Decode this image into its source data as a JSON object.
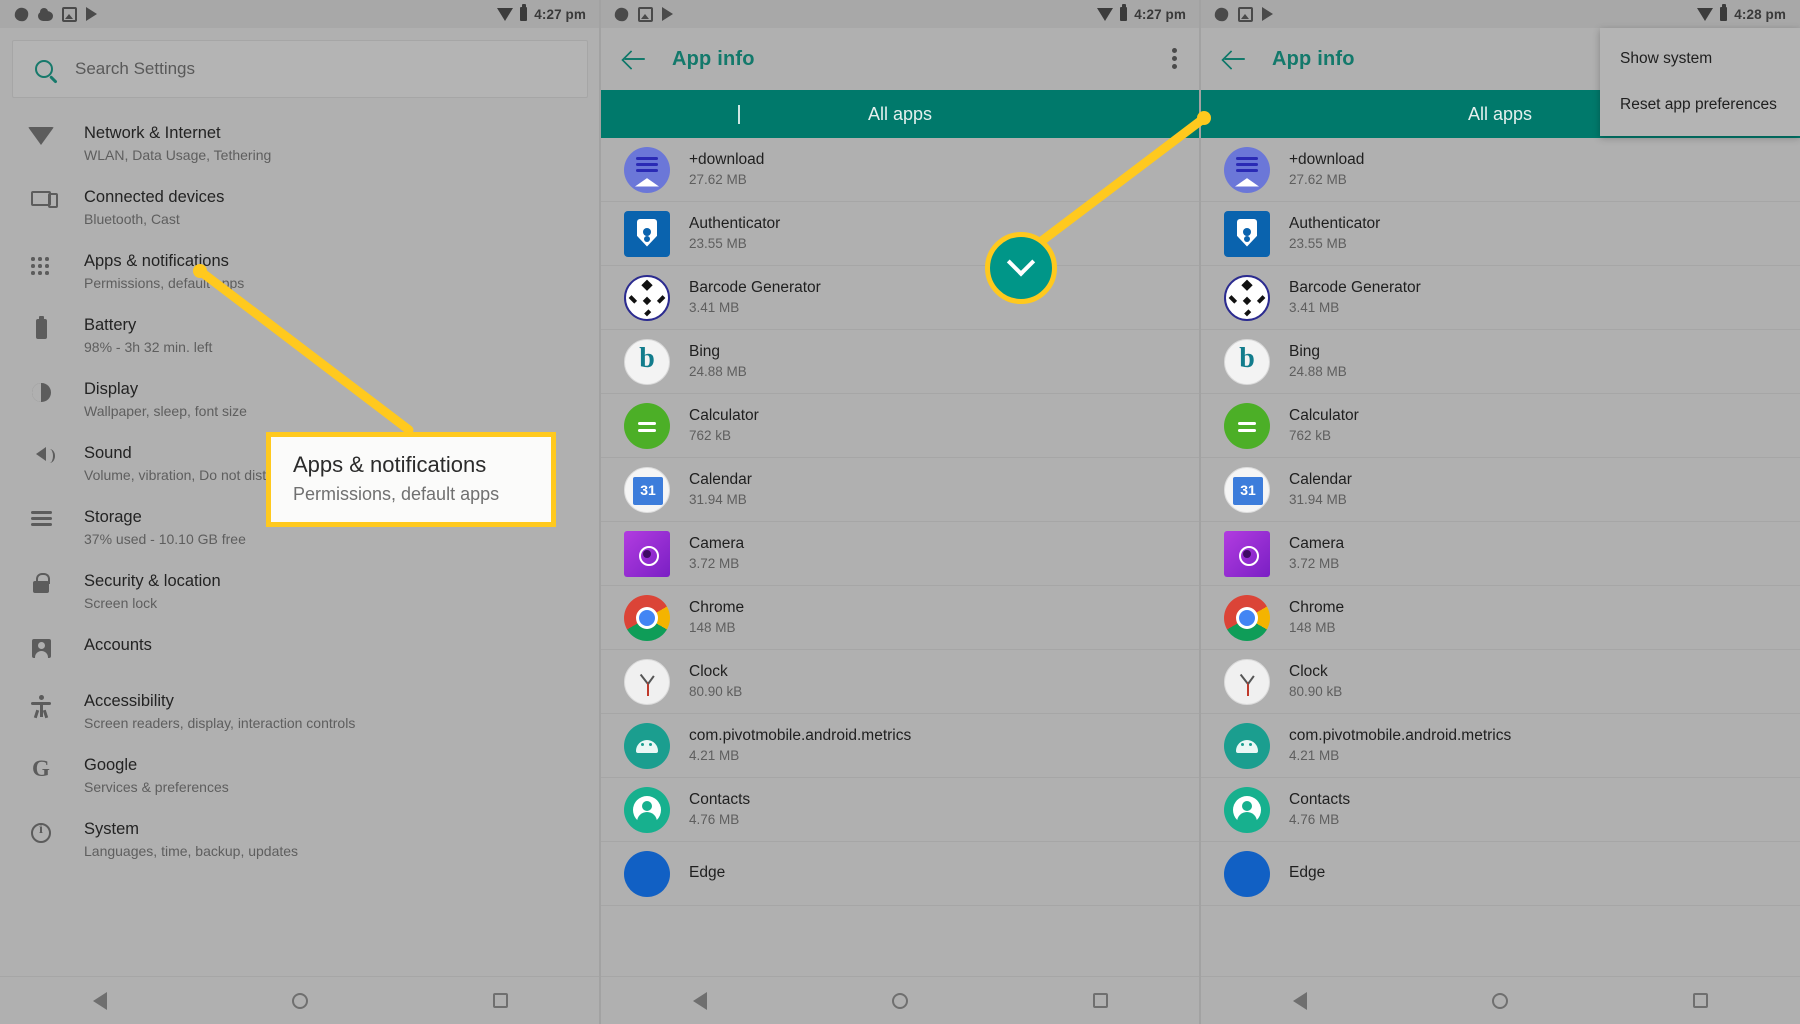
{
  "status_bar": {
    "time_left": "4:27 pm",
    "time_middle": "4:27 pm",
    "time_right": "4:28 pm",
    "icons": [
      "burst-icon",
      "cloud-icon",
      "image-icon",
      "play-icon",
      "wifi-icon",
      "battery-icon"
    ]
  },
  "search": {
    "placeholder": "Search Settings",
    "icon": "search-icon"
  },
  "settings": {
    "items": [
      {
        "icon": "wifi-icon",
        "title": "Network & Internet",
        "subtitle": "WLAN, Data Usage, Tethering"
      },
      {
        "icon": "devices-icon",
        "title": "Connected devices",
        "subtitle": "Bluetooth, Cast"
      },
      {
        "icon": "apps-grid-icon",
        "title": "Apps & notifications",
        "subtitle": "Permissions, default apps"
      },
      {
        "icon": "battery-icon",
        "title": "Battery",
        "subtitle": "98% - 3h 32 min. left"
      },
      {
        "icon": "brightness-icon",
        "title": "Display",
        "subtitle": "Wallpaper, sleep, font size"
      },
      {
        "icon": "speaker-icon",
        "title": "Sound",
        "subtitle": "Volume, vibration, Do not disturb"
      },
      {
        "icon": "storage-icon",
        "title": "Storage",
        "subtitle": "37% used - 10.10 GB free"
      },
      {
        "icon": "lock-icon",
        "title": "Security & location",
        "subtitle": "Screen lock"
      },
      {
        "icon": "account-icon",
        "title": "Accounts",
        "subtitle": ""
      },
      {
        "icon": "accessibility-icon",
        "title": "Accessibility",
        "subtitle": "Screen readers, display, interaction controls"
      },
      {
        "icon": "google-g-icon",
        "title": "Google",
        "subtitle": "Services & preferences"
      },
      {
        "icon": "info-icon",
        "title": "System",
        "subtitle": "Languages, time, backup, updates"
      }
    ]
  },
  "app_info": {
    "title": "App info",
    "back_icon": "back-arrow-icon",
    "overflow_icon": "kebab-menu-icon",
    "filter_label": "All apps",
    "filter_chevron_icon": "chevron-down-icon",
    "apps": [
      {
        "icon": "download-app-icon",
        "name": "+download",
        "size": "27.62 MB"
      },
      {
        "icon": "authenticator-icon",
        "name": "Authenticator",
        "size": "23.55 MB"
      },
      {
        "icon": "barcode-generator-icon",
        "name": "Barcode Generator",
        "size": "3.41 MB"
      },
      {
        "icon": "bing-icon",
        "name": "Bing",
        "size": "24.88 MB"
      },
      {
        "icon": "calculator-icon",
        "name": "Calculator",
        "size": "762 kB"
      },
      {
        "icon": "calendar-icon",
        "name": "Calendar",
        "size": "31.94 MB"
      },
      {
        "icon": "camera-icon",
        "name": "Camera",
        "size": "3.72 MB"
      },
      {
        "icon": "chrome-icon",
        "name": "Chrome",
        "size": "148 MB"
      },
      {
        "icon": "clock-icon",
        "name": "Clock",
        "size": "80.90 kB"
      },
      {
        "icon": "metrics-icon",
        "name": "com.pivotmobile.android.metrics",
        "size": "4.21 MB"
      },
      {
        "icon": "contacts-icon",
        "name": "Contacts",
        "size": "4.76 MB"
      },
      {
        "icon": "edge-icon",
        "name": "Edge",
        "size": ""
      }
    ]
  },
  "overflow_menu": {
    "items": [
      {
        "label": "Show system"
      },
      {
        "label": "Reset app preferences"
      }
    ]
  },
  "annotations": {
    "callout": {
      "title": "Apps & notifications",
      "subtitle": "Permissions, default apps"
    },
    "highlight_icon": "chevron-down-icon",
    "accent_color": "#ffc91e",
    "highlight_fill": "#009688"
  },
  "nav_bar": {
    "items": [
      "back-nav-icon",
      "home-nav-icon",
      "recents-nav-icon"
    ]
  }
}
